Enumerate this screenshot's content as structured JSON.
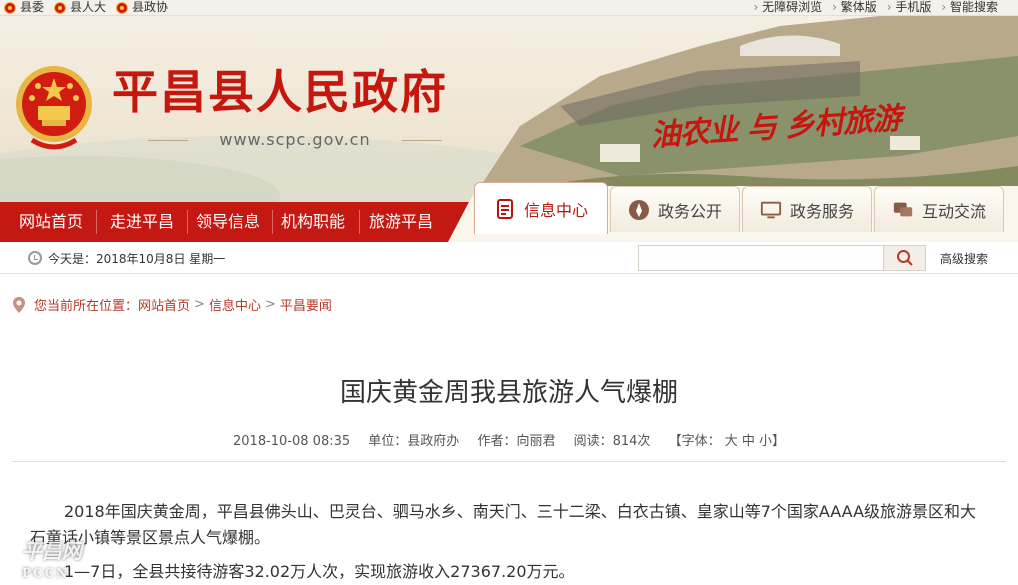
{
  "topbar": {
    "left": [
      {
        "label": "县委"
      },
      {
        "label": "县人大"
      },
      {
        "label": "县政协"
      }
    ],
    "right": [
      {
        "label": "无障碍浏览"
      },
      {
        "label": "繁体版"
      },
      {
        "label": "手机版"
      },
      {
        "label": "智能搜索"
      }
    ]
  },
  "banner": {
    "title": "平昌县人民政府",
    "url": "www.scpc.gov.cn",
    "slogan": "油农业 与 乡村旅游"
  },
  "nav": {
    "items": [
      "网站首页",
      "走进平昌",
      "领导信息",
      "机构职能",
      "旅游平昌"
    ],
    "tabs": [
      "信息中心",
      "政务公开",
      "政务服务",
      "互动交流"
    ]
  },
  "daterow": {
    "date_text": "今天是：2018年10月8日 星期一",
    "search_placeholder": "",
    "advanced_search": "高级搜索"
  },
  "breadcrumb": {
    "prefix": "您当前所在位置：",
    "items": [
      "网站首页",
      "信息中心",
      "平昌要闻"
    ]
  },
  "article": {
    "title": "国庆黄金周我县旅游人气爆棚",
    "datetime": "2018-10-08 08:35",
    "unit": "单位：县政府办",
    "author": "作者：向丽君",
    "views": "阅读：814次",
    "fontsize": "【字体： 大 中 小】",
    "para1_line1": "2018年国庆黄金周，平昌县佛头山、巴灵台、驷马水乡、南天门、三十二梁、白衣古镇、皇家山等7个国家AAAA级旅游景区和大",
    "para1_line2": "石童话小镇等景区景点人气爆棚。",
    "para2": "1—7日，全县共接待游客32.02万人次，实现旅游收入27367.20万元。"
  },
  "watermark": {
    "text": "平昌网",
    "sub": "PCCN"
  },
  "colors": {
    "brand_red": "#c41812",
    "accent_red": "#c6170f"
  }
}
